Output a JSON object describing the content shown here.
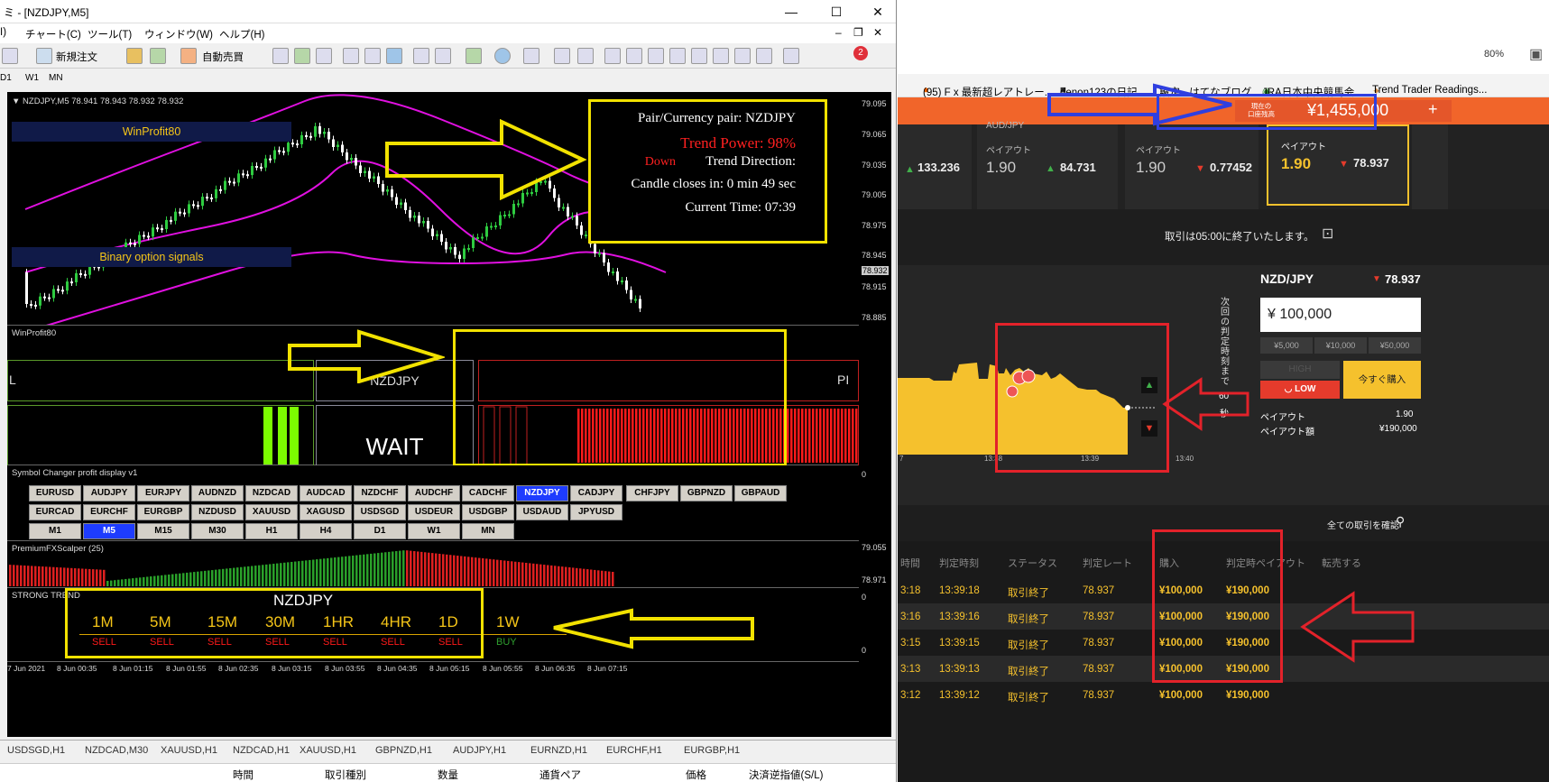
{
  "mt4": {
    "title": "ミ - [NZDJPY,M5]",
    "menu": [
      "I)",
      "チャート(C)",
      "ツール(T)",
      "ウィンドウ(W)",
      "ヘルプ(H)"
    ],
    "toolbar": {
      "new_order": "新規注文",
      "auto_trade": "自動売買",
      "badge": "2"
    },
    "timeframes_small": [
      "D1",
      "W1",
      "MN"
    ],
    "chart_header": "NZDJPY,M5  78.941 78.943 78.932 78.932",
    "price_axis": [
      "79.095",
      "79.065",
      "79.035",
      "79.005",
      "78.975",
      "78.945",
      "78.932",
      "78.915",
      "78.885"
    ],
    "labels": {
      "winprofit": "WinProfit80",
      "binary": "Binary option signals"
    },
    "info_box": {
      "pair": "Pair/Currency pair: NZDJPY",
      "power": "Trend Power: 98%",
      "direction_value": "Down",
      "direction_label": "Trend Direction:",
      "candle": "Candle closes in: 0 min 49 sec",
      "time": "Current Time: 07:39"
    },
    "winprofit_panel": {
      "title": "WinProfit80",
      "symbol": "NZDJPY",
      "left_letter": "L",
      "right_letters": "PI",
      "status": "WAIT"
    },
    "symbol_changer": {
      "title": "Symbol Changer profit display  v1",
      "row1": [
        "EURUSD",
        "AUDJPY",
        "EURJPY",
        "AUDNZD",
        "NZDCAD",
        "AUDCAD",
        "NZDCHF",
        "AUDCHF",
        "CADCHF",
        "NZDJPY",
        "CADJPY",
        "CHFJPY",
        "GBPNZD",
        "GBPAUD"
      ],
      "row2": [
        "EURCAD",
        "EURCHF",
        "EURGBP",
        "NZDUSD",
        "XAUUSD",
        "XAGUSD",
        "USDSGD",
        "USDEUR",
        "USDGBP",
        "USDAUD",
        "JPYUSD"
      ],
      "row3": [
        "M1",
        "M5",
        "M15",
        "M30",
        "H1",
        "H4",
        "D1",
        "W1",
        "MN"
      ],
      "selected_symbol": "NZDJPY",
      "selected_tf": "M5",
      "axis": [
        "0"
      ]
    },
    "scalper": {
      "title": "PremiumFXScalper (25)",
      "axis": [
        "79.055",
        "78.971"
      ]
    },
    "strong_trend": {
      "title": "STRONG TREND",
      "symbol": "NZDJPY",
      "tfs": [
        "1M",
        "5M",
        "15M",
        "30M",
        "1HR",
        "4HR",
        "1D",
        "1W"
      ],
      "signals": [
        "SELL",
        "SELL",
        "SELL",
        "SELL",
        "SELL",
        "SELL",
        "SELL",
        "BUY"
      ],
      "axis": [
        "0",
        "0"
      ]
    },
    "time_axis": [
      "7 Jun 2021",
      "8 Jun 00:35",
      "8 Jun 01:15",
      "8 Jun 01:55",
      "8 Jun 02:35",
      "8 Jun 03:15",
      "8 Jun 03:55",
      "8 Jun 04:35",
      "8 Jun 05:15",
      "8 Jun 05:55",
      "8 Jun 06:35",
      "8 Jun 07:15"
    ],
    "bottom_tabs": [
      "USDSGD,H1",
      "NZDCAD,M30",
      "XAUUSD,H1",
      "NZDCAD,H1",
      "XAUUSD,H1",
      "GBPNZD,H1",
      "AUDJPY,H1",
      "EURNZD,H1",
      "EURCHF,H1",
      "EURGBP,H1"
    ],
    "terminal_headers": [
      "時間",
      "取引種別",
      "数量",
      "通貨ペア",
      "価格",
      "決済逆指値(S/L)"
    ]
  },
  "browser": {
    "zoom": "80%",
    "bookmarks": [
      "(95) F x 最新超レアトレー...",
      "denon123の日記",
      "設定 - はてなブログ",
      "JRA日本中央競馬会",
      "Trend Trader Readings..."
    ],
    "balance_label_1": "現在の",
    "balance_label_2": "口座残高",
    "balance": "¥1,455,000",
    "balance_plus": "+"
  },
  "site": {
    "cards": [
      {
        "pair": "",
        "payout_label": "",
        "payout": "",
        "rate": "133.236"
      },
      {
        "pair": "AUD/JPY",
        "payout_label": "ペイアウト",
        "payout": "1.90",
        "rate": "84.731"
      },
      {
        "pair": "",
        "payout_label": "ペイアウト",
        "payout": "1.90",
        "rate": "0.77452"
      },
      {
        "pair": "",
        "payout_label": "ペイアウト",
        "payout": "1.90",
        "rate": "78.937"
      }
    ],
    "round_end": "取引は05:00に終了いたします。",
    "pair": "NZD/JPY",
    "pair_rate": "78.937",
    "amount": "¥ 100,000",
    "quick_amounts": [
      "¥5,000",
      "¥10,000",
      "¥50,000"
    ],
    "high_label": "HIGH",
    "low_label": "LOW",
    "buy_now": "今すぐ購入",
    "payout_label": "ペイアウト",
    "payout": "1.90",
    "payout_amount_label": "ペイアウト額",
    "payout_amount": "¥190,000",
    "countdown_vertical": "次回の判定時刻まで",
    "countdown_value": "60",
    "countdown_unit": "秒",
    "chart_times": [
      "7",
      "13:38",
      "13:39",
      "13:40"
    ],
    "view_all": "全ての取引を確認",
    "history_headers": [
      "時間",
      "判定時刻",
      "ステータス",
      "判定レート",
      "購入",
      "判定時ペイアウト",
      "転売する"
    ],
    "history": [
      {
        "time": "3:18",
        "judge": "13:39:18",
        "status": "取引終了",
        "rate": "78.937",
        "buy": "¥100,000",
        "payout": "¥190,000"
      },
      {
        "time": "3:16",
        "judge": "13:39:16",
        "status": "取引終了",
        "rate": "78.937",
        "buy": "¥100,000",
        "payout": "¥190,000"
      },
      {
        "time": "3:15",
        "judge": "13:39:15",
        "status": "取引終了",
        "rate": "78.937",
        "buy": "¥100,000",
        "payout": "¥190,000"
      },
      {
        "time": "3:13",
        "judge": "13:39:13",
        "status": "取引終了",
        "rate": "78.937",
        "buy": "¥100,000",
        "payout": "¥190,000"
      },
      {
        "time": "3:12",
        "judge": "13:39:12",
        "status": "取引終了",
        "rate": "78.937",
        "buy": "¥100,000",
        "payout": "¥190,000"
      }
    ]
  },
  "colors": {
    "accent_orange": "#f1652a",
    "gold": "#f5c12d",
    "annot_yellow": "#f2e200",
    "annot_red": "#e3222a",
    "annot_blue": "#2f3fe0",
    "sell_red": "#ff1a1a",
    "buy_green": "#2fa02f"
  }
}
